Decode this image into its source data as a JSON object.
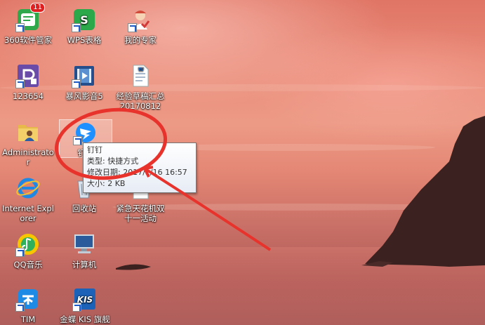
{
  "desktop": {
    "icons": [
      {
        "label": "360软件管家",
        "icon": "360-software-manager-icon",
        "badge": "11"
      },
      {
        "label": "WPS表格",
        "icon": "wps-spreadsheet-icon"
      },
      {
        "label": "我的专家",
        "icon": "my-expert-icon"
      },
      {
        "label": "123654",
        "icon": "app-123654-icon"
      },
      {
        "label": "暴风影音5",
        "icon": "baofeng-player-icon"
      },
      {
        "label": "经验草稿汇总20170812",
        "icon": "word-document-icon"
      },
      {
        "label": "Administrator",
        "icon": "user-folder-icon"
      },
      {
        "label": "钉钉",
        "icon": "dingtalk-icon"
      },
      {
        "label": "Internet Explorer",
        "icon": "internet-explorer-icon"
      },
      {
        "label": "回收站",
        "icon": "recycle-bin-icon"
      },
      {
        "label": "紧急天花机双十一活动",
        "icon": "document-icon"
      },
      {
        "label": "QQ音乐",
        "icon": "qq-music-icon"
      },
      {
        "label": "计算机",
        "icon": "computer-icon"
      },
      {
        "label": "TIM",
        "icon": "tim-icon"
      },
      {
        "label": "金蝶 KIS 旗舰",
        "icon": "kingdee-kis-icon"
      }
    ]
  },
  "tooltip": {
    "title": "钉钉",
    "type": "类型: 快捷方式",
    "modified": "修改日期: 2017/1/16 16:57",
    "size": "大小: 2 KB"
  },
  "colors": {
    "annotation": "#e8322c",
    "selection": "#ffffff"
  }
}
